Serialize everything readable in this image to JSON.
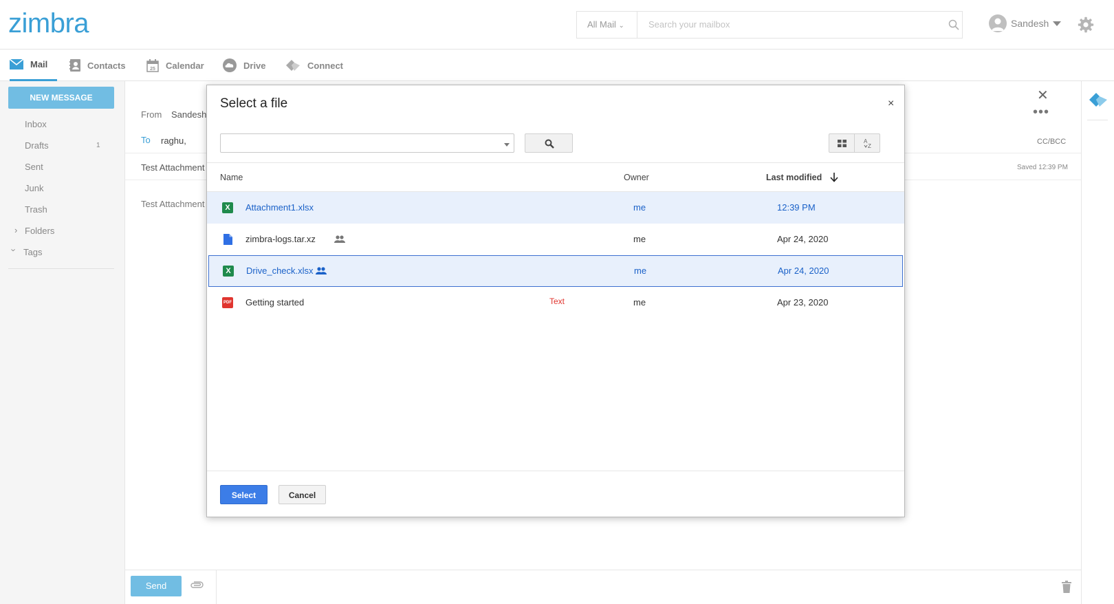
{
  "header": {
    "logo": "zimbra",
    "scope_label": "All Mail",
    "search_placeholder": "Search your mailbox",
    "user_name": "Sandesh"
  },
  "nav": {
    "tabs": [
      {
        "label": "Mail",
        "icon": "envelope-icon",
        "active": true
      },
      {
        "label": "Contacts",
        "icon": "contacts-icon"
      },
      {
        "label": "Calendar",
        "icon": "calendar-icon"
      },
      {
        "label": "Drive",
        "icon": "cloud-icon"
      },
      {
        "label": "Connect",
        "icon": "connect-icon"
      }
    ]
  },
  "sidebar": {
    "new_message": "NEW MESSAGE",
    "folders": [
      {
        "label": "Inbox"
      },
      {
        "label": "Drafts",
        "count": "1"
      },
      {
        "label": "Sent"
      },
      {
        "label": "Junk"
      },
      {
        "label": "Trash"
      },
      {
        "label": "Folders"
      },
      {
        "label": "Tags"
      }
    ]
  },
  "compose": {
    "from_label": "From",
    "from_value": "Sandesh",
    "to_label": "To",
    "to_value": "raghu,",
    "subject": "Test Attachment",
    "body": "Test Attachment",
    "cc_bcc": "CC/BCC",
    "saved": "Saved 12:39 PM",
    "send": "Send"
  },
  "modal": {
    "title": "Select a file",
    "close": "×",
    "columns": {
      "name": "Name",
      "owner": "Owner",
      "modified": "Last modified"
    },
    "files": [
      {
        "name": "Attachment1.xlsx",
        "type": "xlsx",
        "owner": "me",
        "modified": "12:39 PM",
        "shared": false,
        "selected": true
      },
      {
        "name": "zimbra-logs.tar.xz",
        "type": "file",
        "owner": "me",
        "modified": "Apr 24, 2020",
        "shared": true,
        "selected": false
      },
      {
        "name": "Drive_check.xlsx",
        "type": "xlsx",
        "owner": "me",
        "modified": "Apr 24, 2020",
        "shared": true,
        "selected": true
      },
      {
        "name": "Getting started",
        "type": "pdf",
        "owner": "me",
        "modified": "Apr 23, 2020",
        "shared": false,
        "selected": false,
        "tag": "Text"
      }
    ],
    "select_label": "Select",
    "cancel_label": "Cancel"
  },
  "colors": {
    "brand": "#3a9fd6",
    "primary_button": "#3c7de7",
    "selection": "#e8f0fc",
    "link_selected": "#1a61c8"
  }
}
